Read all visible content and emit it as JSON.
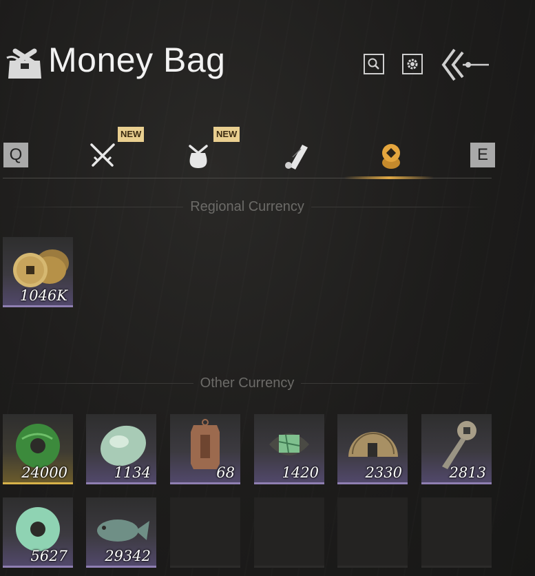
{
  "header": {
    "title": "Money Bag"
  },
  "keys": {
    "prev": "Q",
    "next": "E"
  },
  "tabs": [
    {
      "icon": "crossed-swords-icon",
      "badge": "NEW"
    },
    {
      "icon": "pouch-icon",
      "badge": "NEW"
    },
    {
      "icon": "scroll-icon",
      "badge": ""
    },
    {
      "icon": "coins-icon",
      "badge": "",
      "active": true
    }
  ],
  "sections": {
    "regional": "Regional Currency",
    "other": "Other Currency"
  },
  "regional_items": [
    {
      "icon": "copper-coins-icon",
      "amount": "1046K"
    }
  ],
  "other_items": [
    {
      "icon": "green-jade-ring-icon",
      "amount": "24000"
    },
    {
      "icon": "jade-pebble-icon",
      "amount": "1134"
    },
    {
      "icon": "bronze-tablet-icon",
      "amount": "68"
    },
    {
      "icon": "jade-map-icon",
      "amount": "1420"
    },
    {
      "icon": "half-coin-icon",
      "amount": "2330"
    },
    {
      "icon": "coin-key-icon",
      "amount": "2813"
    },
    {
      "icon": "pale-jade-ring-icon",
      "amount": "5627"
    },
    {
      "icon": "jade-fish-icon",
      "amount": "29342"
    }
  ],
  "colors": {
    "active_tab": "#e0a946",
    "slot_purple": "#8f7fb2",
    "slot_gold": "#d8b24a"
  }
}
